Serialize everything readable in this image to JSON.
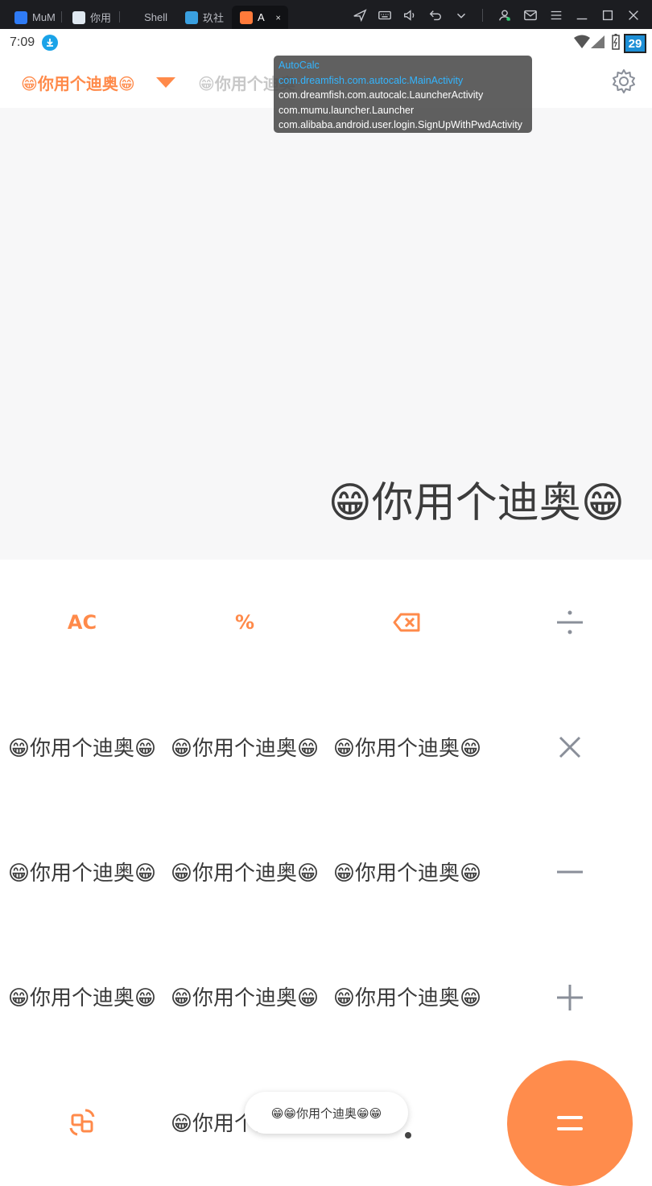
{
  "titlebar": {
    "tabs": [
      {
        "label": "MuM",
        "color": "#2f7bf5"
      },
      {
        "label": "你用",
        "color": "#dfe8f0"
      },
      {
        "label": "Shell",
        "color": "#1c1d21"
      },
      {
        "label": "玖社",
        "color": "#3aa0e0"
      },
      {
        "label": "A",
        "color": "#ff7a3a"
      }
    ],
    "icons": [
      "plane-icon",
      "keyboard-icon",
      "volume-icon",
      "undo-icon",
      "chevron-down-icon",
      "user-icon",
      "mail-icon",
      "menu-icon",
      "minimize-icon",
      "maximize-icon",
      "close-icon"
    ]
  },
  "statusbar": {
    "time": "7:09",
    "battery_level": "29"
  },
  "header": {
    "active_mode": "😁你用个迪奥😁",
    "inactive_mode": "😁你用个迪奥"
  },
  "display": {
    "value": "😁你用个迪奥😁"
  },
  "keypad": {
    "ac": "AC",
    "percent": "%",
    "key_text": "😁你用个迪奥😁",
    "equals_icon": "equals-icon",
    "colors": {
      "accent": "#ff8a4a",
      "operator": "#8a8f99"
    }
  },
  "toast": "😁😁你用个迪奥😁😁",
  "tooltip": {
    "lines": [
      "AutoCalc",
      "com.dreamfish.com.autocalc.MainActivity",
      "com.dreamfish.com.autocalc.LauncherActivity",
      "com.mumu.launcher.Launcher",
      "com.alibaba.android.user.login.SignUpWithPwdActivity"
    ]
  }
}
